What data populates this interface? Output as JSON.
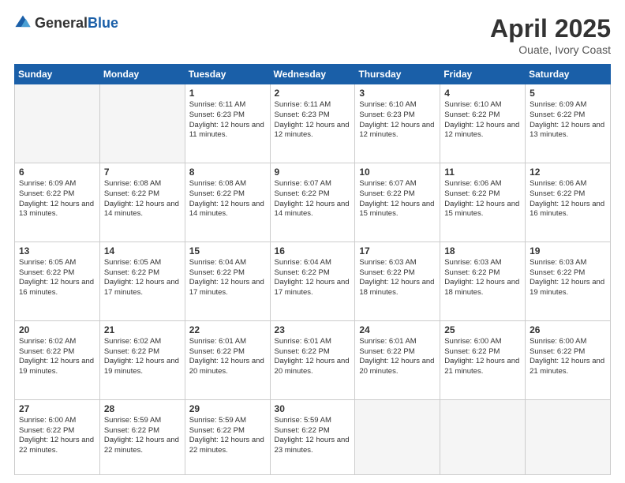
{
  "header": {
    "logo_general": "General",
    "logo_blue": "Blue",
    "month_title": "April 2025",
    "location": "Ouate, Ivory Coast"
  },
  "weekdays": [
    "Sunday",
    "Monday",
    "Tuesday",
    "Wednesday",
    "Thursday",
    "Friday",
    "Saturday"
  ],
  "weeks": [
    [
      {
        "day": "",
        "info": ""
      },
      {
        "day": "",
        "info": ""
      },
      {
        "day": "1",
        "info": "Sunrise: 6:11 AM\nSunset: 6:23 PM\nDaylight: 12 hours and 11 minutes."
      },
      {
        "day": "2",
        "info": "Sunrise: 6:11 AM\nSunset: 6:23 PM\nDaylight: 12 hours and 12 minutes."
      },
      {
        "day": "3",
        "info": "Sunrise: 6:10 AM\nSunset: 6:23 PM\nDaylight: 12 hours and 12 minutes."
      },
      {
        "day": "4",
        "info": "Sunrise: 6:10 AM\nSunset: 6:22 PM\nDaylight: 12 hours and 12 minutes."
      },
      {
        "day": "5",
        "info": "Sunrise: 6:09 AM\nSunset: 6:22 PM\nDaylight: 12 hours and 13 minutes."
      }
    ],
    [
      {
        "day": "6",
        "info": "Sunrise: 6:09 AM\nSunset: 6:22 PM\nDaylight: 12 hours and 13 minutes."
      },
      {
        "day": "7",
        "info": "Sunrise: 6:08 AM\nSunset: 6:22 PM\nDaylight: 12 hours and 14 minutes."
      },
      {
        "day": "8",
        "info": "Sunrise: 6:08 AM\nSunset: 6:22 PM\nDaylight: 12 hours and 14 minutes."
      },
      {
        "day": "9",
        "info": "Sunrise: 6:07 AM\nSunset: 6:22 PM\nDaylight: 12 hours and 14 minutes."
      },
      {
        "day": "10",
        "info": "Sunrise: 6:07 AM\nSunset: 6:22 PM\nDaylight: 12 hours and 15 minutes."
      },
      {
        "day": "11",
        "info": "Sunrise: 6:06 AM\nSunset: 6:22 PM\nDaylight: 12 hours and 15 minutes."
      },
      {
        "day": "12",
        "info": "Sunrise: 6:06 AM\nSunset: 6:22 PM\nDaylight: 12 hours and 16 minutes."
      }
    ],
    [
      {
        "day": "13",
        "info": "Sunrise: 6:05 AM\nSunset: 6:22 PM\nDaylight: 12 hours and 16 minutes."
      },
      {
        "day": "14",
        "info": "Sunrise: 6:05 AM\nSunset: 6:22 PM\nDaylight: 12 hours and 17 minutes."
      },
      {
        "day": "15",
        "info": "Sunrise: 6:04 AM\nSunset: 6:22 PM\nDaylight: 12 hours and 17 minutes."
      },
      {
        "day": "16",
        "info": "Sunrise: 6:04 AM\nSunset: 6:22 PM\nDaylight: 12 hours and 17 minutes."
      },
      {
        "day": "17",
        "info": "Sunrise: 6:03 AM\nSunset: 6:22 PM\nDaylight: 12 hours and 18 minutes."
      },
      {
        "day": "18",
        "info": "Sunrise: 6:03 AM\nSunset: 6:22 PM\nDaylight: 12 hours and 18 minutes."
      },
      {
        "day": "19",
        "info": "Sunrise: 6:03 AM\nSunset: 6:22 PM\nDaylight: 12 hours and 19 minutes."
      }
    ],
    [
      {
        "day": "20",
        "info": "Sunrise: 6:02 AM\nSunset: 6:22 PM\nDaylight: 12 hours and 19 minutes."
      },
      {
        "day": "21",
        "info": "Sunrise: 6:02 AM\nSunset: 6:22 PM\nDaylight: 12 hours and 19 minutes."
      },
      {
        "day": "22",
        "info": "Sunrise: 6:01 AM\nSunset: 6:22 PM\nDaylight: 12 hours and 20 minutes."
      },
      {
        "day": "23",
        "info": "Sunrise: 6:01 AM\nSunset: 6:22 PM\nDaylight: 12 hours and 20 minutes."
      },
      {
        "day": "24",
        "info": "Sunrise: 6:01 AM\nSunset: 6:22 PM\nDaylight: 12 hours and 20 minutes."
      },
      {
        "day": "25",
        "info": "Sunrise: 6:00 AM\nSunset: 6:22 PM\nDaylight: 12 hours and 21 minutes."
      },
      {
        "day": "26",
        "info": "Sunrise: 6:00 AM\nSunset: 6:22 PM\nDaylight: 12 hours and 21 minutes."
      }
    ],
    [
      {
        "day": "27",
        "info": "Sunrise: 6:00 AM\nSunset: 6:22 PM\nDaylight: 12 hours and 22 minutes."
      },
      {
        "day": "28",
        "info": "Sunrise: 5:59 AM\nSunset: 6:22 PM\nDaylight: 12 hours and 22 minutes."
      },
      {
        "day": "29",
        "info": "Sunrise: 5:59 AM\nSunset: 6:22 PM\nDaylight: 12 hours and 22 minutes."
      },
      {
        "day": "30",
        "info": "Sunrise: 5:59 AM\nSunset: 6:22 PM\nDaylight: 12 hours and 23 minutes."
      },
      {
        "day": "",
        "info": ""
      },
      {
        "day": "",
        "info": ""
      },
      {
        "day": "",
        "info": ""
      }
    ]
  ]
}
